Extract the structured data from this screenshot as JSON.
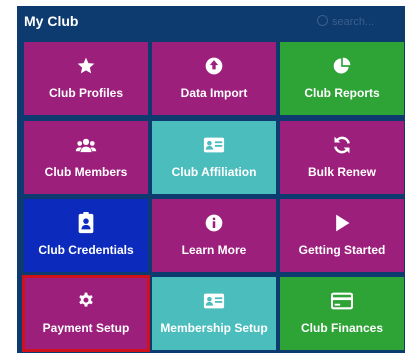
{
  "panel": {
    "title": "My Club",
    "search_hint": "search..."
  },
  "tiles": [
    {
      "label": "Club Profiles",
      "icon": "star-icon",
      "color": "#9c1f7c"
    },
    {
      "label": "Data Import",
      "icon": "upload-icon",
      "color": "#9c1f7c"
    },
    {
      "label": "Club Reports",
      "icon": "pie-chart-icon",
      "color": "#2ea336"
    },
    {
      "label": "Club Members",
      "icon": "users-icon",
      "color": "#9c1f7c"
    },
    {
      "label": "Club Affiliation",
      "icon": "id-card-icon",
      "color": "#4cbdbd"
    },
    {
      "label": "Bulk Renew",
      "icon": "refresh-icon",
      "color": "#9c1f7c"
    },
    {
      "label": "Club Credentials",
      "icon": "id-badge-icon",
      "color": "#0c2bbd"
    },
    {
      "label": "Learn More",
      "icon": "info-icon",
      "color": "#9c1f7c"
    },
    {
      "label": "Getting Started",
      "icon": "play-icon",
      "color": "#9c1f7c"
    },
    {
      "label": "Payment Setup",
      "icon": "gear-icon",
      "color": "#9c1f7c",
      "selected": true
    },
    {
      "label": "Membership Setup",
      "icon": "id-card-icon",
      "color": "#4cbdbd"
    },
    {
      "label": "Club Finances",
      "icon": "credit-card-icon",
      "color": "#2ea336"
    }
  ],
  "colors": {
    "panel_bg": "#0d3a6f",
    "magenta": "#9c1f7c",
    "teal": "#4cbdbd",
    "green": "#2ea336",
    "blue": "#0c2bbd",
    "selection_border": "#d0101b"
  }
}
